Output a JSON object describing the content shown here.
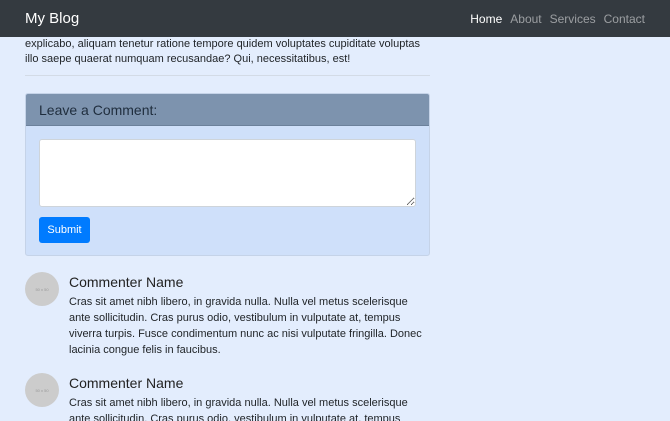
{
  "nav": {
    "brand": "My Blog",
    "links": [
      "Home",
      "About",
      "Services",
      "Contact"
    ]
  },
  "intro": "explicabo, aliquam tenetur ratione tempore quidem voluptates cupiditate voluptas illo saepe quaerat numquam recusandae? Qui, necessitatibus, est!",
  "comment_form": {
    "title": "Leave a Comment:",
    "textarea_value": "",
    "submit": "Submit"
  },
  "comments": [
    {
      "avatar": "50 x 50",
      "name": "Commenter Name",
      "text": "Cras sit amet nibh libero, in gravida nulla. Nulla vel metus scelerisque ante sollicitudin. Cras purus odio, vestibulum in vulputate at, tempus viverra turpis. Fusce condimentum nunc ac nisi vulputate fringilla. Donec lacinia congue felis in faucibus."
    },
    {
      "avatar": "50 x 50",
      "name": "Commenter Name",
      "text": "Cras sit amet nibh libero, in gravida nulla. Nulla vel metus scelerisque ante sollicitudin. Cras purus odio, vestibulum in vulputate at, tempus viverra turpis. Fusce condimentum nunc ac nisi vulputate fringilla. Donec lacinia congue felis in faucibus."
    }
  ]
}
